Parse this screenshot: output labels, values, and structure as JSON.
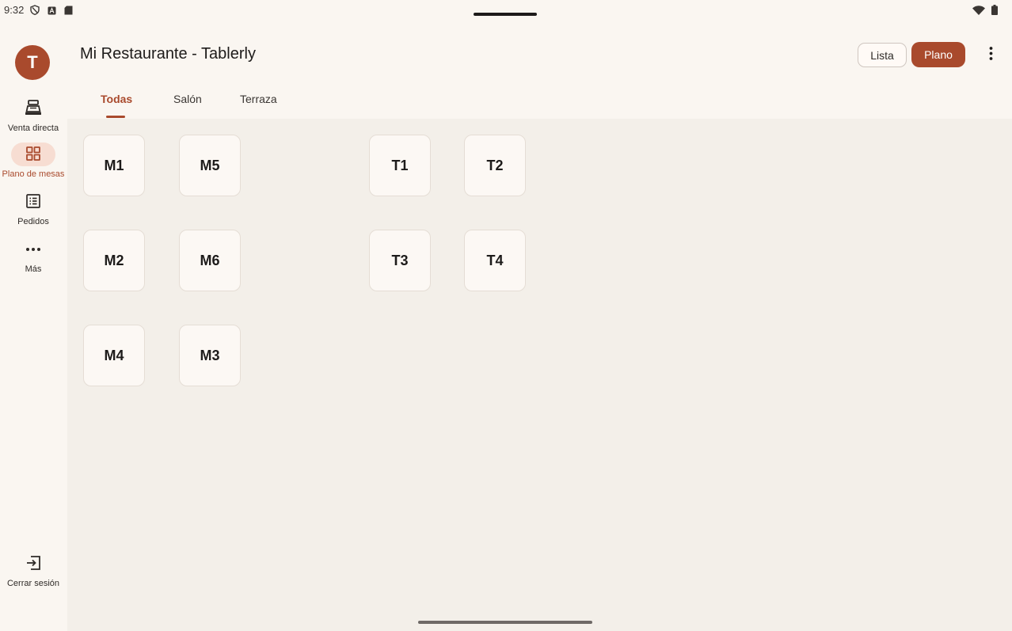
{
  "status": {
    "time": "9:32",
    "left_icons": [
      "shield-icon",
      "font-icon",
      "sd-card-icon"
    ],
    "right_icons": [
      "wifi-icon",
      "battery-icon"
    ]
  },
  "rail": {
    "avatar_letter": "T",
    "items": [
      {
        "label": "Venta directa",
        "icon": "cash-register-icon",
        "active": false
      },
      {
        "label": "Plano de mesas",
        "icon": "grid-icon",
        "active": true
      },
      {
        "label": "Pedidos",
        "icon": "list-icon",
        "active": false
      },
      {
        "label": "Más",
        "icon": "more-horizontal-icon",
        "active": false
      }
    ],
    "logout_label": "Cerrar sesión"
  },
  "header": {
    "title": "Mi Restaurante - Tablerly",
    "view_toggle": {
      "list_label": "Lista",
      "plan_label": "Plano",
      "selected": "Plano"
    }
  },
  "tabs": [
    {
      "label": "Todas",
      "active": true
    },
    {
      "label": "Salón",
      "active": false
    },
    {
      "label": "Terraza",
      "active": false
    }
  ],
  "tables": {
    "salon": [
      "M1",
      "M5",
      "M2",
      "M6",
      "M4",
      "M3"
    ],
    "terraza": [
      "T1",
      "T2",
      "T3",
      "T4"
    ]
  },
  "colors": {
    "accent": "#a94a2d",
    "background": "#faf6f1",
    "canvas": "#f3efe9",
    "active_pill": "#f7ddd2"
  }
}
